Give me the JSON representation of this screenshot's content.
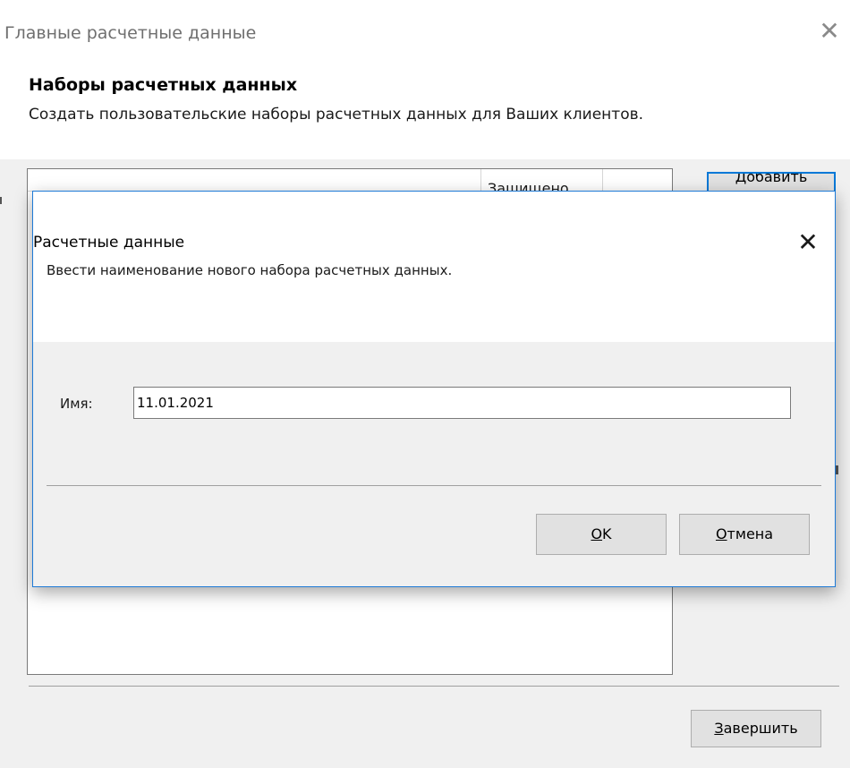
{
  "parent_window": {
    "title": "Главные расчетные данные",
    "close_glyph": "✕",
    "heading": "Наборы расчетных данных",
    "subtext": "Создать пользовательские наборы расчетных данных для Ваших клиентов.",
    "list": {
      "column_protected": "Защищено"
    },
    "add_button": "Добавить",
    "finish_button": {
      "mnemonic": "З",
      "rest": "авершить"
    }
  },
  "dialog": {
    "title": "Расчетные данные",
    "close_glyph": "✕",
    "instruction": "Ввести наименование нового набора расчетных данных.",
    "name_label": "Имя:",
    "name_value": "11.01.2021",
    "ok_button": {
      "mnemonic": "O",
      "rest": "K"
    },
    "cancel_button": {
      "mnemonic": "О",
      "rest": "тмена"
    }
  },
  "colors": {
    "accent": "#0078d7",
    "dialog_border": "#1e7ad6",
    "body_bg": "#f0f0f0",
    "button_bg": "#e1e1e1"
  }
}
